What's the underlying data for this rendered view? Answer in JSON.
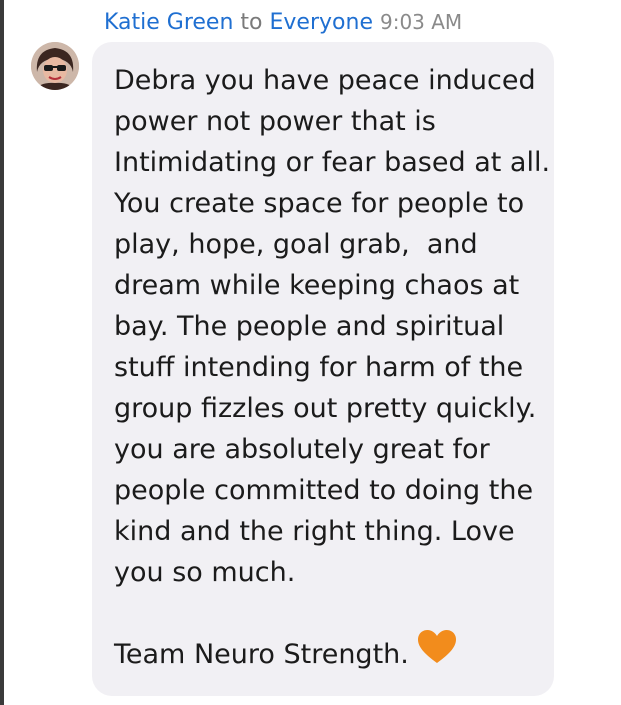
{
  "header": {
    "sender": "Katie Green",
    "to_word": "to",
    "recipient": "Everyone",
    "time": "9:03 AM"
  },
  "message": {
    "lines": [
      "Debra you have peace induced",
      "power not power that is",
      "Intimidating or fear based at all.",
      "You create space for people to",
      "play, hope, goal grab,  and",
      "dream while keeping chaos at",
      "bay. The people and spiritual",
      "stuff intending for harm of the",
      "group fizzles out pretty quickly.",
      "you are absolutely great for",
      "people committed to doing the",
      "kind and the right thing. Love",
      "you so much."
    ],
    "signoff": "Team Neuro Strength.",
    "emoji": "orange-heart",
    "emoji_color": "#f28c1c"
  },
  "colors": {
    "name_link": "#1f6fd1",
    "bubble_bg": "#f1f0f4"
  }
}
